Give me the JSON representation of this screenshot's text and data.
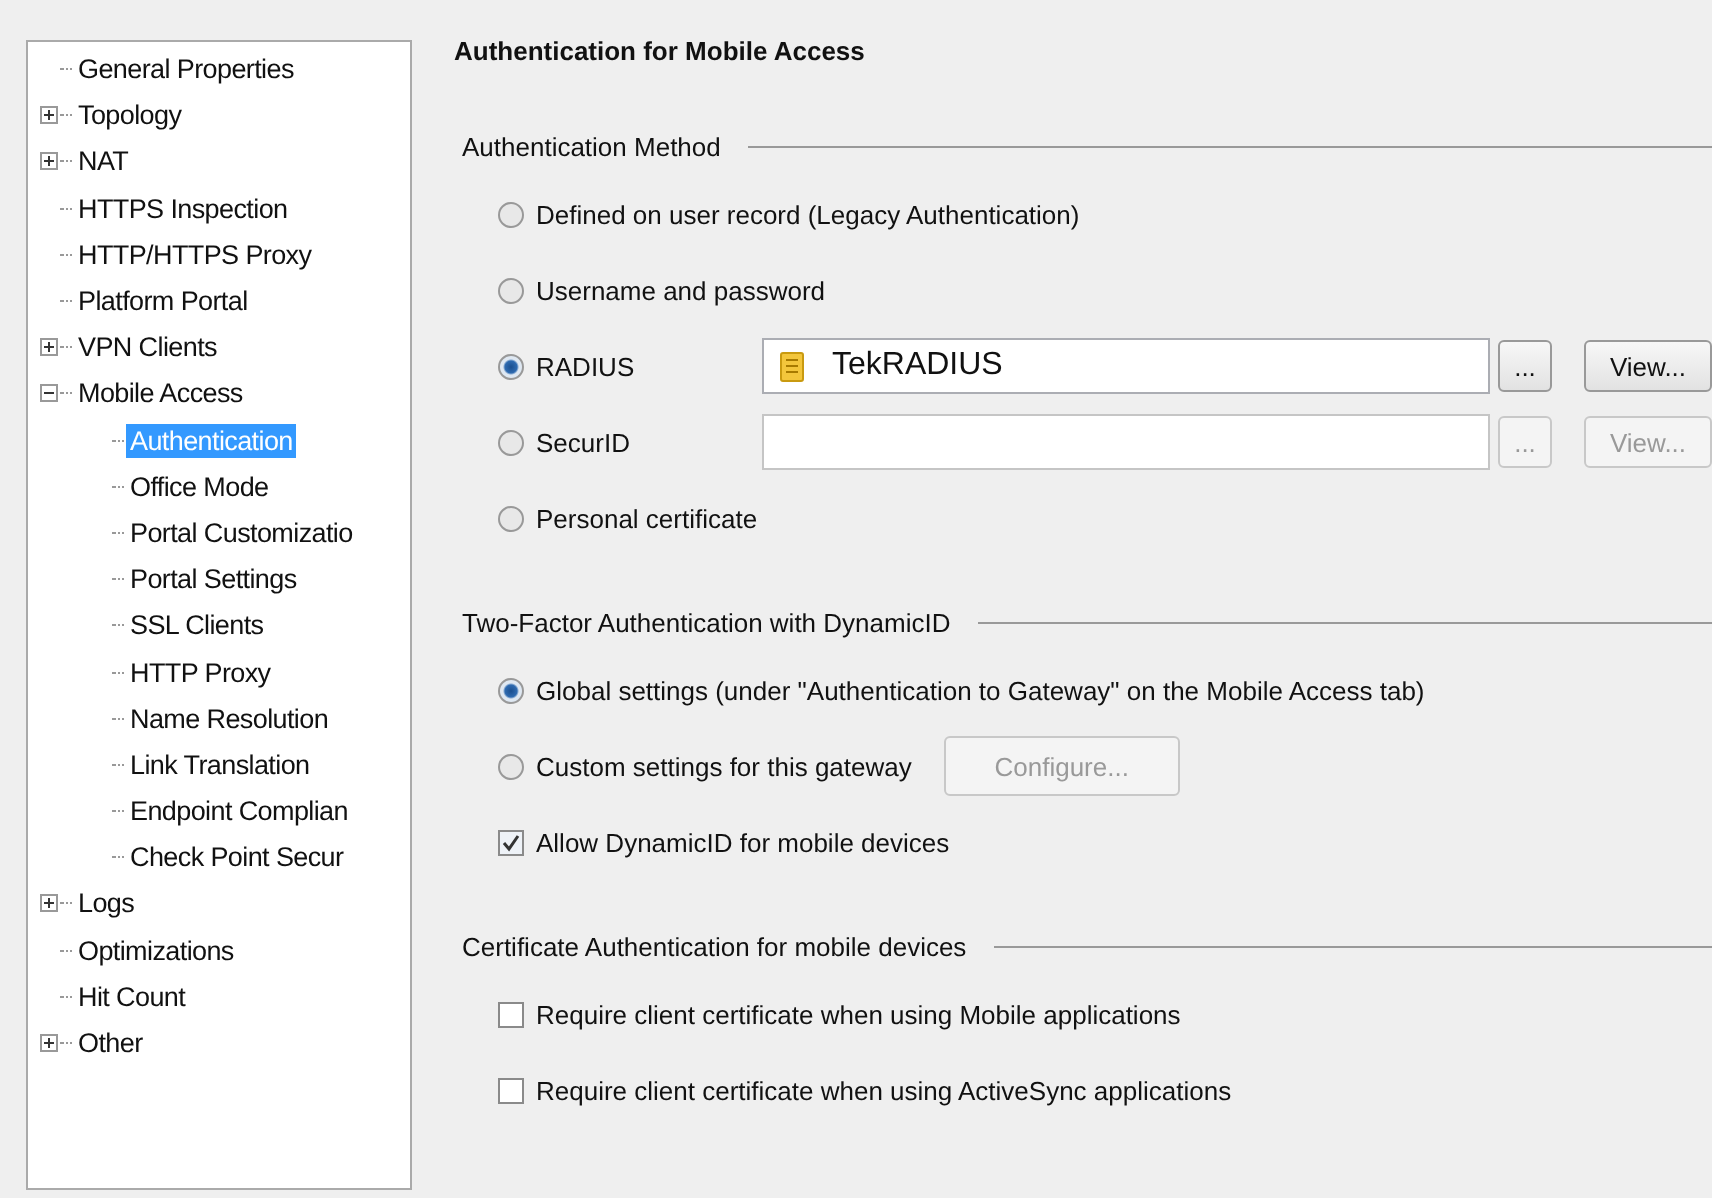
{
  "tree": [
    {
      "label": "General Properties",
      "selected": false
    },
    {
      "label": "Topology",
      "selected": false,
      "expanded": false
    },
    {
      "label": "NAT",
      "selected": false,
      "expanded": false
    },
    {
      "label": "HTTPS Inspection",
      "selected": false
    },
    {
      "label": "HTTP/HTTPS Proxy",
      "selected": false
    },
    {
      "label": "Platform Portal",
      "selected": false
    },
    {
      "label": "VPN Clients",
      "selected": false,
      "expanded": false
    },
    {
      "label": "Mobile Access",
      "selected": false,
      "expanded": true,
      "children": [
        {
          "label": "Authentication",
          "selected": true
        },
        {
          "label": "Office Mode",
          "selected": false
        },
        {
          "label": "Portal Customizatio",
          "selected": false
        },
        {
          "label": "Portal Settings",
          "selected": false
        },
        {
          "label": "SSL Clients",
          "selected": false
        },
        {
          "label": "HTTP Proxy",
          "selected": false
        },
        {
          "label": "Name Resolution",
          "selected": false
        },
        {
          "label": "Link Translation",
          "selected": false
        },
        {
          "label": "Endpoint Complian",
          "selected": false
        },
        {
          "label": "Check Point Secur",
          "selected": false
        }
      ]
    },
    {
      "label": "Logs",
      "selected": false,
      "expanded": false
    },
    {
      "label": "Optimizations",
      "selected": false
    },
    {
      "label": "Hit Count",
      "selected": false
    },
    {
      "label": "Other",
      "selected": false,
      "expanded": false
    }
  ],
  "page_title": "Authentication for Mobile Access",
  "sections": [
    {
      "title": "Authentication Method",
      "options": [
        {
          "kind": "radio",
          "label": "Defined on user record  (Legacy Authentication)",
          "selected": false
        },
        {
          "kind": "radio",
          "label": "Username and password",
          "selected": false
        },
        {
          "kind": "radio",
          "label": "RADIUS",
          "selected": true,
          "field": {
            "value": "TekRADIUS",
            "disabled": false
          },
          "buttons": [
            {
              "label": "...",
              "disabled": false
            },
            {
              "label": "View...",
              "disabled": false
            }
          ]
        },
        {
          "kind": "radio",
          "label": "SecurID",
          "selected": false,
          "field": {
            "disabled": true
          },
          "buttons": [
            {
              "label": "...",
              "disabled": true
            },
            {
              "label": "View...",
              "disabled": true
            }
          ]
        },
        {
          "kind": "radio",
          "label": "Personal certificate",
          "selected": false
        }
      ]
    },
    {
      "title": "Two-Factor Authentication with DynamicID",
      "options": [
        {
          "kind": "radio",
          "label": "Global settings (under \"Authentication to Gateway\" on the Mobile Access tab)",
          "selected": true
        },
        {
          "kind": "radio",
          "label": "Custom settings for this gateway",
          "selected": false,
          "buttons": [
            {
              "label": "Configure...",
              "disabled": true
            }
          ]
        },
        {
          "kind": "checkbox",
          "label": "Allow DynamicID for mobile devices",
          "checked": true
        }
      ]
    },
    {
      "title": "Certificate Authentication for mobile devices",
      "options": [
        {
          "kind": "checkbox",
          "label": "Require client certificate when using Mobile applications",
          "checked": false
        },
        {
          "kind": "checkbox",
          "label": "Require client certificate when using ActiveSync applications",
          "checked": false
        }
      ]
    }
  ]
}
